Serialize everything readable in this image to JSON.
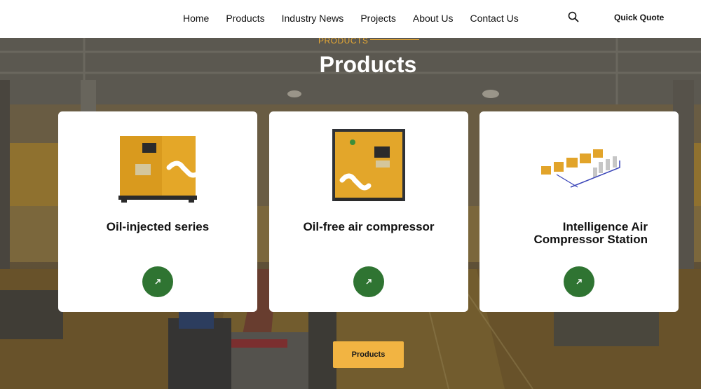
{
  "header": {
    "nav": [
      "Home",
      "Products",
      "Industry News",
      "Projects",
      "About Us",
      "Contact Us"
    ],
    "quick_quote": "Quick Quote",
    "search_icon": "search-icon"
  },
  "section": {
    "tag": "PRODUCTS",
    "title": "Products"
  },
  "cards": [
    {
      "title": "Oil-injected series",
      "image": "oil-injected-compressor-image",
      "button_icon": "arrow-up-right-icon"
    },
    {
      "title": "Oil-free air compressor",
      "image": "oil-free-compressor-image",
      "button_icon": "arrow-up-right-icon"
    },
    {
      "title": "Intelligence Air Compressor Station",
      "image": "compressor-station-image",
      "button_icon": "arrow-up-right-icon"
    }
  ],
  "products_button": "Products",
  "colors": {
    "accent": "#f2b442",
    "tag": "#e6a834",
    "button_green": "#2f7432"
  }
}
